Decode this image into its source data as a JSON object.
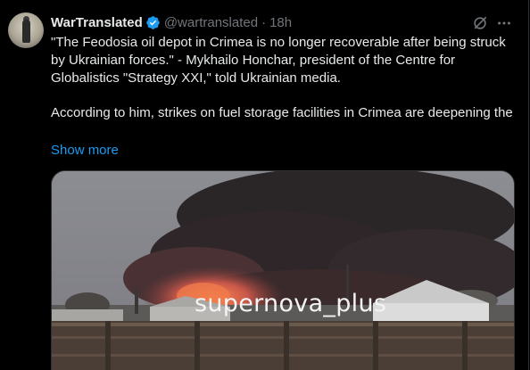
{
  "tweet": {
    "display_name": "WarTranslated",
    "handle": "@wartranslated",
    "separator": "·",
    "time": "18h",
    "paragraphs": [
      "\"The Feodosia oil depot in Crimea is no longer recoverable after being struck by Ukrainian forces.\" - Mykhailo Honchar, president of the Centre for Globalistics \"Strategy XXI,\" told Ukrainian media.",
      "According to him, strikes on fuel storage facilities in Crimea are deepening the"
    ],
    "show_more_label": "Show more",
    "media": {
      "watermark": "supernova_plus"
    }
  },
  "colors": {
    "background": "#000000",
    "text": "#e7e9ea",
    "secondary_text": "#71767b",
    "link": "#1d9bf0",
    "verified": "#1d9bf0"
  },
  "icons": {
    "verified": "verified-badge-icon",
    "grok": "grok-icon",
    "more": "more-options-icon"
  }
}
